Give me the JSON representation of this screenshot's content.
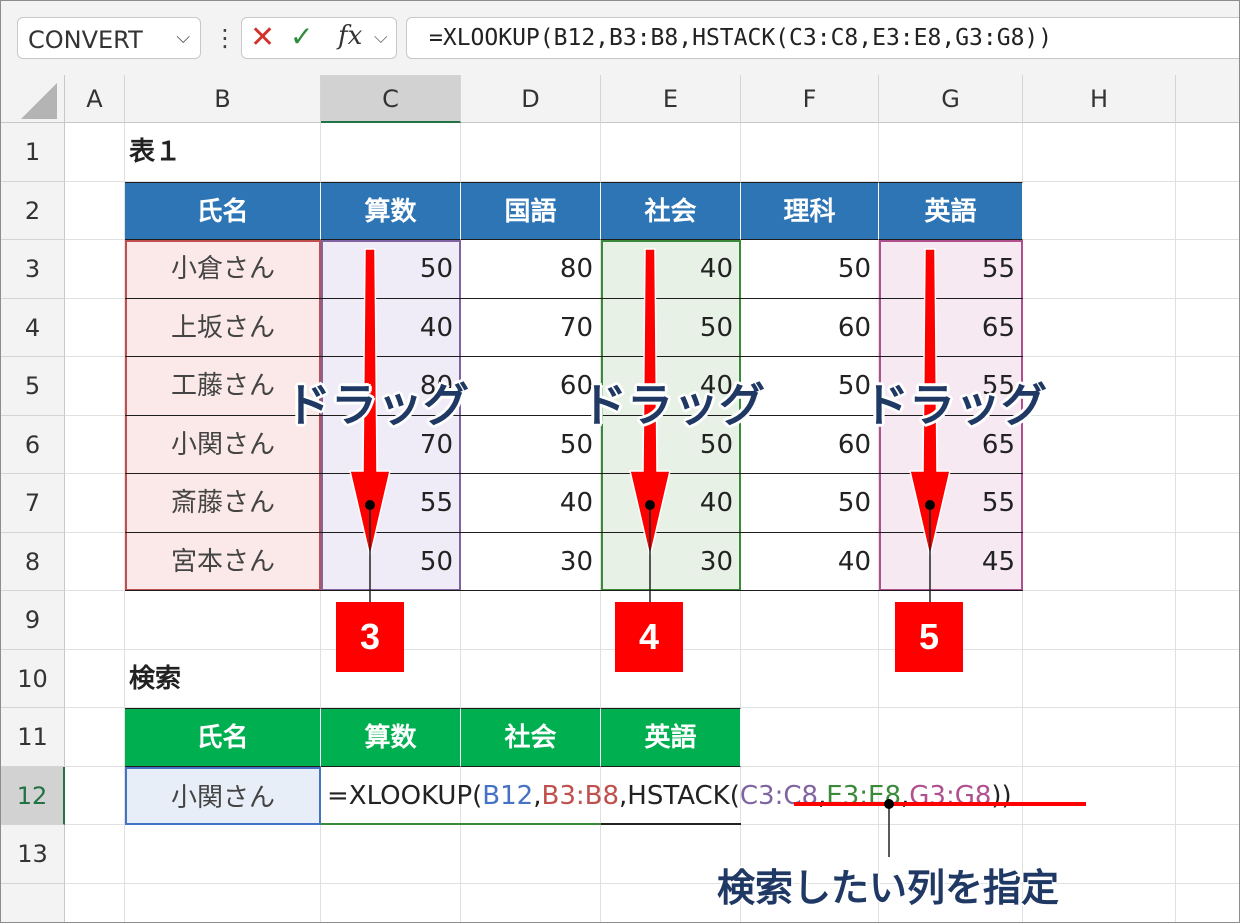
{
  "formula_bar": {
    "name_box": "CONVERT",
    "cancel_icon": "x-icon",
    "enter_icon": "check-icon",
    "fx_label": "fx",
    "formula": "=XLOOKUP(B12,B3:B8,HSTACK(C3:C8,E3:E8,G3:G8))"
  },
  "columns": [
    "A",
    "B",
    "C",
    "D",
    "E",
    "F",
    "G",
    "H"
  ],
  "rows": [
    "1",
    "2",
    "3",
    "4",
    "5",
    "6",
    "7",
    "8",
    "9",
    "10",
    "11",
    "12",
    "13"
  ],
  "table1": {
    "title": "表１",
    "headers": [
      "氏名",
      "算数",
      "国語",
      "社会",
      "理科",
      "英語"
    ],
    "rows": [
      [
        "小倉さん",
        "50",
        "80",
        "40",
        "50",
        "55"
      ],
      [
        "上坂さん",
        "40",
        "70",
        "50",
        "60",
        "65"
      ],
      [
        "工藤さん",
        "80",
        "60",
        "40",
        "50",
        "55"
      ],
      [
        "小関さん",
        "70",
        "50",
        "50",
        "60",
        "65"
      ],
      [
        "斎藤さん",
        "55",
        "40",
        "40",
        "50",
        "55"
      ],
      [
        "宮本さん",
        "50",
        "30",
        "30",
        "40",
        "45"
      ]
    ]
  },
  "search": {
    "title": "検索",
    "headers": [
      "氏名",
      "算数",
      "社会",
      "英語"
    ],
    "name_value": "小関さん",
    "formula_parts": [
      "=XLOOKUP(",
      "B12",
      ",",
      "B3:B8",
      ",HSTACK(",
      "C3:C8",
      ",",
      "E3:E8",
      ",",
      "G3:G8",
      "))"
    ]
  },
  "annotations": {
    "drag_label": "ドラッグ",
    "badges": [
      "3",
      "4",
      "5"
    ],
    "note": "検索したい列を指定"
  },
  "colors": {
    "header_blue": "#2e75b6",
    "header_green": "#00b050",
    "ref_blue": "#4472c4",
    "ref_red": "#c0504d",
    "ref_purple": "#8064a2",
    "ref_green": "#3a8a3a",
    "ref_magenta": "#b0508f",
    "arrow_red": "#ff0000"
  }
}
